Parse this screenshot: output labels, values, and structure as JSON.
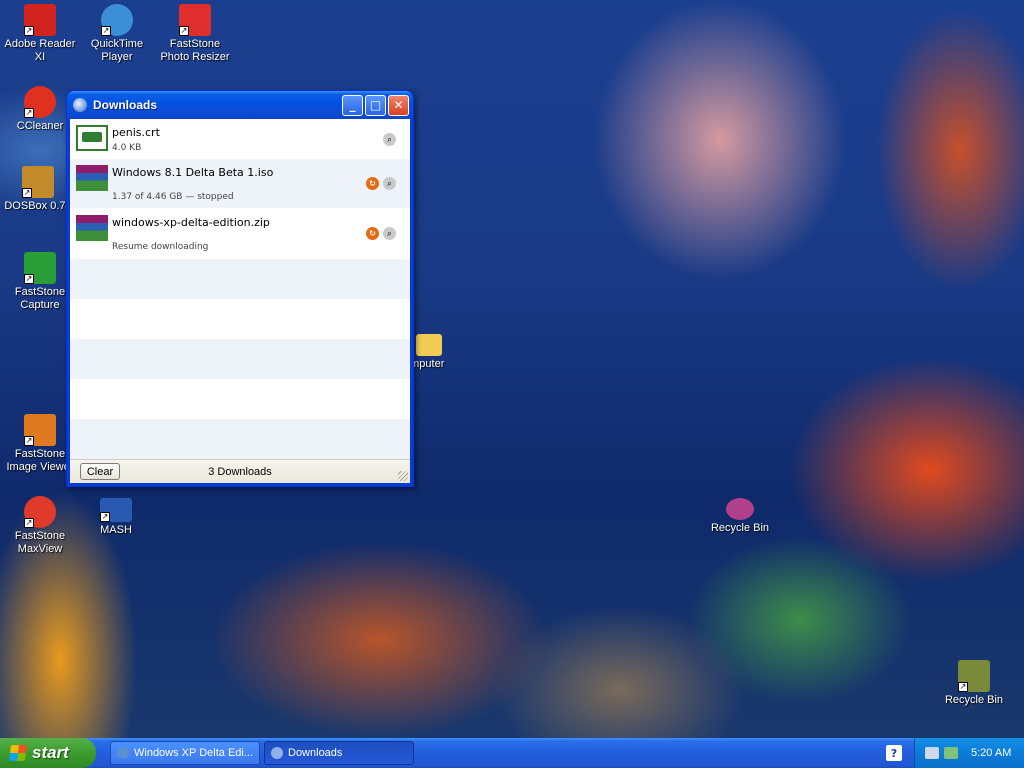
{
  "desktop_icons": [
    {
      "label": "Adobe Reader XI",
      "icon": "pdf-icon",
      "color": "#d1241f"
    },
    {
      "label": "QuickTime Player",
      "icon": "quicktime-icon",
      "color": "#3b8fd6"
    },
    {
      "label": "FastStone Photo Resizer",
      "icon": "photo-resizer-icon",
      "color": "#e02d2d"
    },
    {
      "label": "CCleaner",
      "icon": "ccleaner-icon",
      "color": "#e03020"
    },
    {
      "label": "DOSBox 0.74",
      "icon": "dosbox-icon",
      "color": "#c38a2c"
    },
    {
      "label": "FastStone Capture",
      "icon": "capture-icon",
      "color": "#2a9d38"
    },
    {
      "label": "FastStone Image Viewer",
      "icon": "image-viewer-icon",
      "color": "#e07a20"
    },
    {
      "label": "FastStone MaxView",
      "icon": "maxview-icon",
      "color": "#e03a2a"
    },
    {
      "label": "MASH",
      "icon": "mash-icon",
      "color": "#2a5ab0"
    },
    {
      "label": "omputer",
      "icon": "folder-icon",
      "color": "#f2cc55"
    },
    {
      "label": "Recycle Bin",
      "icon": "recycle-bin-icon",
      "color": "#b0408a"
    },
    {
      "label": "Recycle Bin",
      "icon": "recycle-bin-full-icon",
      "color": "#7a8a3a"
    }
  ],
  "window": {
    "title": "Downloads",
    "minimize": "_",
    "maximize": "□",
    "close": "✕"
  },
  "downloads": [
    {
      "name": "penis.crt",
      "status": "4.0 KB",
      "icon": "certificate-icon",
      "retry": false
    },
    {
      "name": "Windows 8.1 Delta Beta 1.iso",
      "status": "1.37 of 4.46 GB — stopped",
      "icon": "winrar-archive-icon",
      "retry": true
    },
    {
      "name": "windows-xp-delta-edition.zip",
      "status": "Resume downloading",
      "icon": "winrar-archive-icon",
      "retry": true
    }
  ],
  "footer": {
    "clear_label": "Clear",
    "count_label": "3 Downloads"
  },
  "taskbar": {
    "start_label": "start",
    "tasks": [
      {
        "label": "Windows XP Delta Edi...",
        "active": false
      },
      {
        "label": "Downloads",
        "active": true
      }
    ],
    "help": "?",
    "clock": "5:20 AM"
  },
  "colors": {
    "titlebar": "#0a5ee8",
    "start_button": "#3c9c2e",
    "taskbar": "#245edb",
    "tray": "#0c7cd9"
  }
}
